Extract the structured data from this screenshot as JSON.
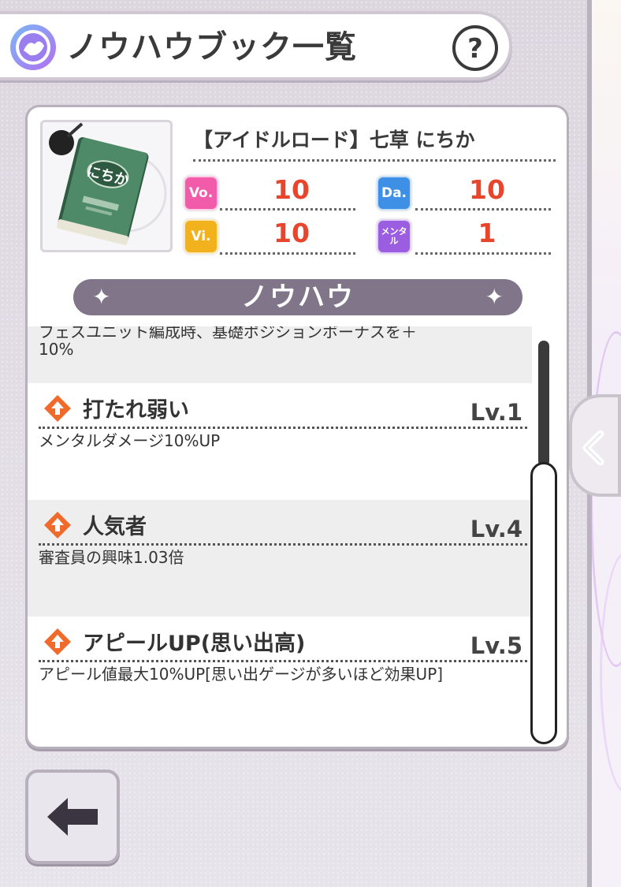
{
  "header": {
    "title": "ノウハウブック一覧",
    "help_label": "?"
  },
  "card": {
    "name": "【アイドルロード】七草 にちか",
    "book_label": "にちか",
    "stats": [
      {
        "key": "vo",
        "icon_label": "Vo.",
        "value": "10",
        "color": "#f25ba9"
      },
      {
        "key": "da",
        "icon_label": "Da.",
        "value": "10",
        "color": "#3e8fe6"
      },
      {
        "key": "vi",
        "icon_label": "Vi.",
        "value": "10",
        "color": "#f2b21e"
      },
      {
        "key": "mental",
        "icon_label": "メンタル",
        "value": "1",
        "color": "#9b5ee0"
      }
    ]
  },
  "section": {
    "title": "ノウハウ",
    "star_left": "✦",
    "star_right": "✦"
  },
  "knowhow": {
    "partial_desc_line1": "フェスユニット編成時、基礎ポジションボーナスを＋",
    "partial_desc_line2": "10%",
    "items": [
      {
        "title": "打たれ弱い",
        "level": "Lv.1",
        "desc": "メンタルダメージ10%UP"
      },
      {
        "title": "人気者",
        "level": "Lv.4",
        "desc": "審査員の興味1.03倍"
      },
      {
        "title": "アピールUP(思い出高)",
        "level": "Lv.5",
        "desc": "アピール値最大10%UP[思い出ゲージが多いほど効果UP]"
      }
    ]
  },
  "colors": {
    "accent_red": "#e8452d",
    "banner": "#817689"
  }
}
